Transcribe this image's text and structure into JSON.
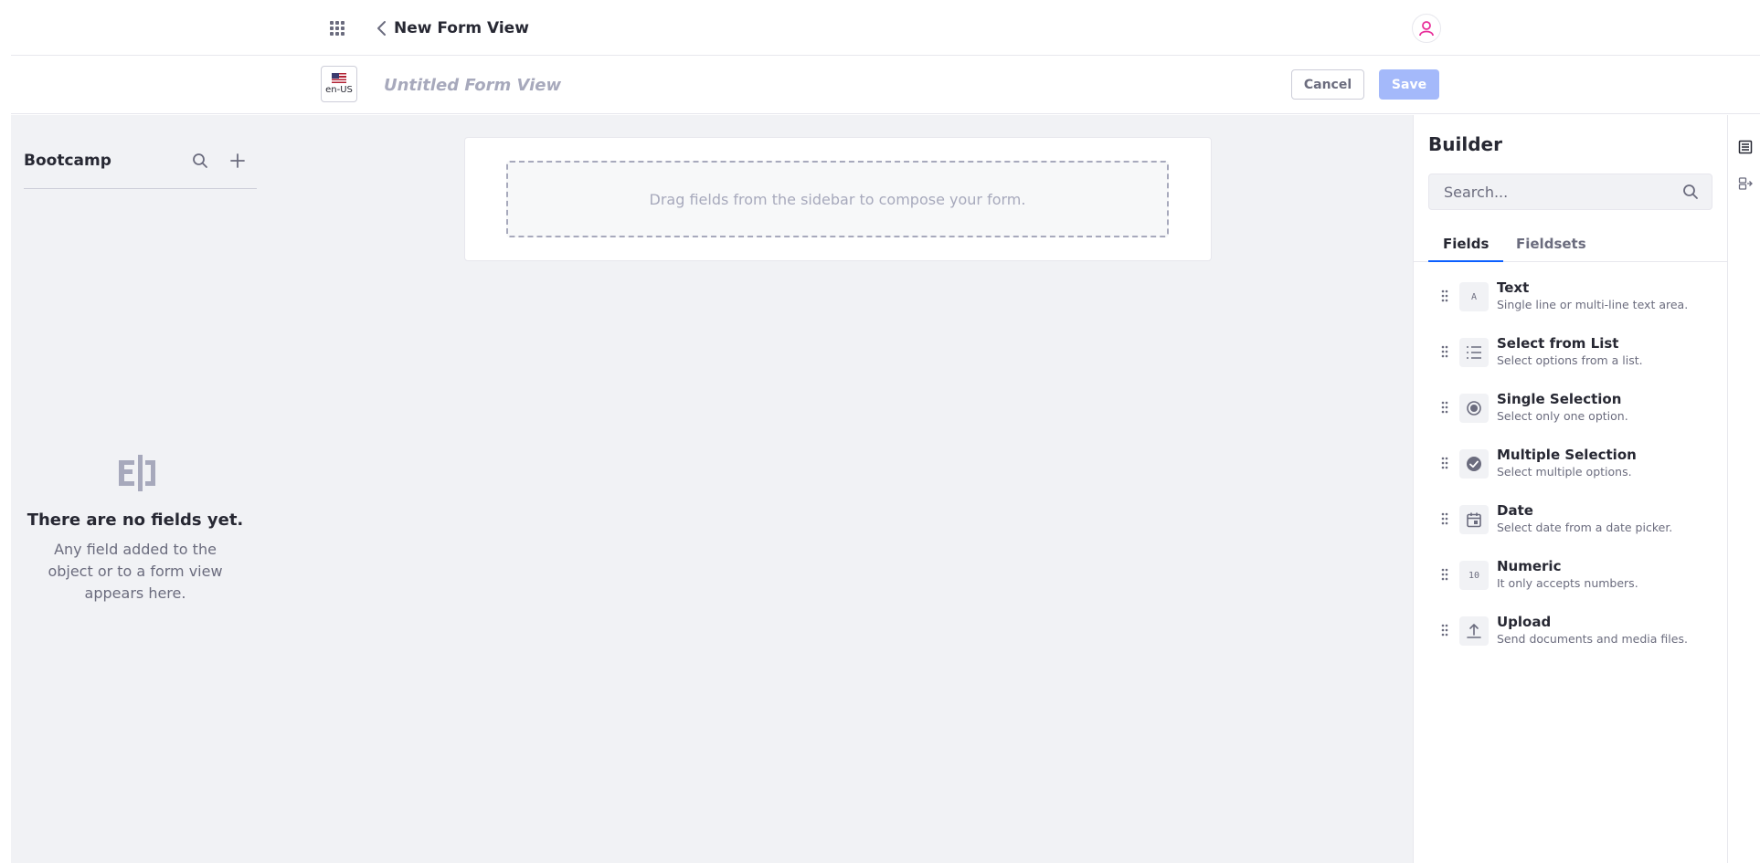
{
  "topbar": {
    "title": "New Form View",
    "apps_icon": "apps-grid-icon",
    "back_icon": "chevron-left-icon",
    "avatar_icon": "user-icon"
  },
  "subbar": {
    "locale": "en-US",
    "form_name_placeholder": "Untitled Form View",
    "cancel_label": "Cancel",
    "save_label": "Save"
  },
  "left_panel": {
    "title": "Bootcamp",
    "empty_title": "There are no fields yet.",
    "empty_description": "Any field added to the object or to a form view appears here."
  },
  "canvas": {
    "dropzone_text": "Drag fields from the sidebar to compose your form."
  },
  "builder": {
    "title": "Builder",
    "search_placeholder": "Search...",
    "tabs": [
      {
        "label": "Fields",
        "active": true
      },
      {
        "label": "Fieldsets",
        "active": false
      }
    ],
    "fields": [
      {
        "label": "Text",
        "description": "Single line or multi-line text area.",
        "icon": "text-icon",
        "glyph": "A"
      },
      {
        "label": "Select from List",
        "description": "Select options from a list.",
        "icon": "list-icon",
        "glyph": ""
      },
      {
        "label": "Single Selection",
        "description": "Select only one option.",
        "icon": "radio-icon",
        "glyph": ""
      },
      {
        "label": "Multiple Selection",
        "description": "Select multiple options.",
        "icon": "check-circle-icon",
        "glyph": ""
      },
      {
        "label": "Date",
        "description": "Select date from a date picker.",
        "icon": "calendar-icon",
        "glyph": ""
      },
      {
        "label": "Numeric",
        "description": "It only accepts numbers.",
        "icon": "numeric-icon",
        "glyph": "10"
      },
      {
        "label": "Upload",
        "description": "Send documents and media files.",
        "icon": "upload-icon",
        "glyph": ""
      }
    ]
  },
  "colors": {
    "primary": "#0b5fff",
    "save_disabled": "#a4b9fa",
    "avatar": "#e82f9a",
    "canvas_bg": "#f1f2f5"
  }
}
